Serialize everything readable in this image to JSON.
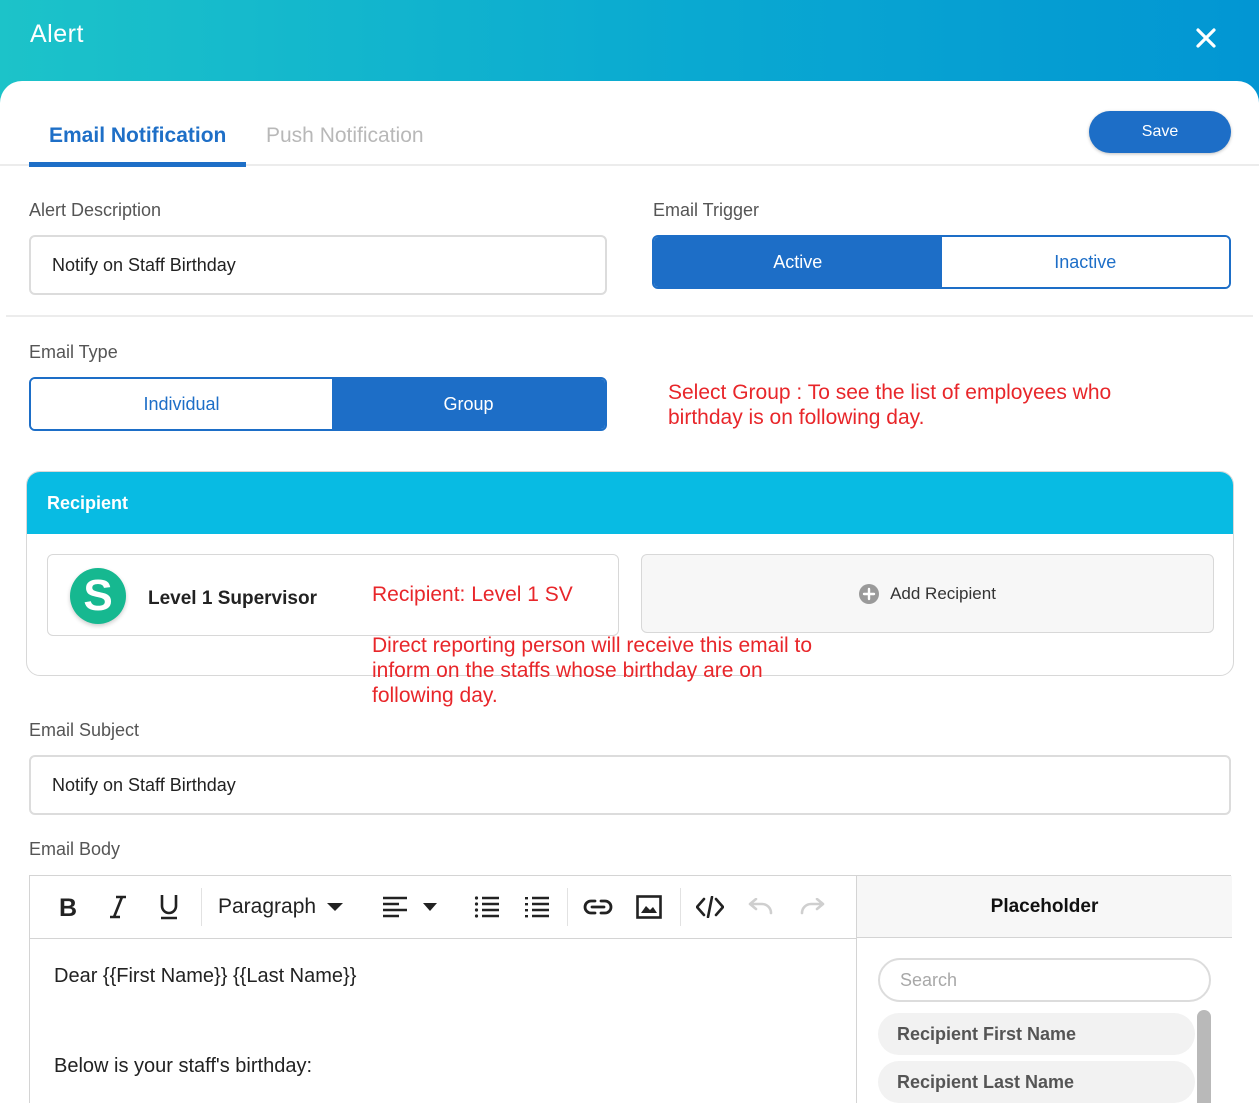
{
  "header": {
    "title": "Alert"
  },
  "tabs": [
    {
      "label": "Email Notification",
      "active": true
    },
    {
      "label": "Push Notification",
      "active": false
    }
  ],
  "save_label": "Save",
  "alert_description": {
    "label": "Alert Description",
    "value": "Notify on Staff Birthday"
  },
  "email_trigger": {
    "label": "Email Trigger",
    "options": [
      "Active",
      "Inactive"
    ],
    "selected": "Active"
  },
  "email_type": {
    "label": "Email Type",
    "options": [
      "Individual",
      "Group"
    ],
    "selected": "Group"
  },
  "annotations": {
    "group_note_1": "Select Group : To see the list of employees who",
    "group_note_2": "birthday is on following day.",
    "recipient_note": "Recipient: Level 1 SV",
    "direct_note_1": "Direct reporting person will receive this email to",
    "direct_note_2": "inform on the staffs whose birthday are on",
    "direct_note_3": "following day."
  },
  "recipient": {
    "title": "Recipient",
    "avatar_letter": "S",
    "name": "Level 1 Supervisor",
    "add_label": "Add Recipient"
  },
  "email_subject": {
    "label": "Email Subject",
    "value": "Notify on Staff Birthday"
  },
  "email_body": {
    "label": "Email Body",
    "format_select": "Paragraph",
    "lines": [
      "Dear {{First Name}} {{Last Name}}",
      "Below is your staff's birthday:"
    ]
  },
  "placeholder": {
    "title": "Placeholder",
    "search_placeholder": "Search",
    "items": [
      "Recipient First Name",
      "Recipient Last Name"
    ]
  },
  "colors": {
    "accent": "#1d6ec7",
    "header_teal": "#08bbe3",
    "annotation_red": "#e8262a",
    "avatar_green": "#16b890"
  }
}
